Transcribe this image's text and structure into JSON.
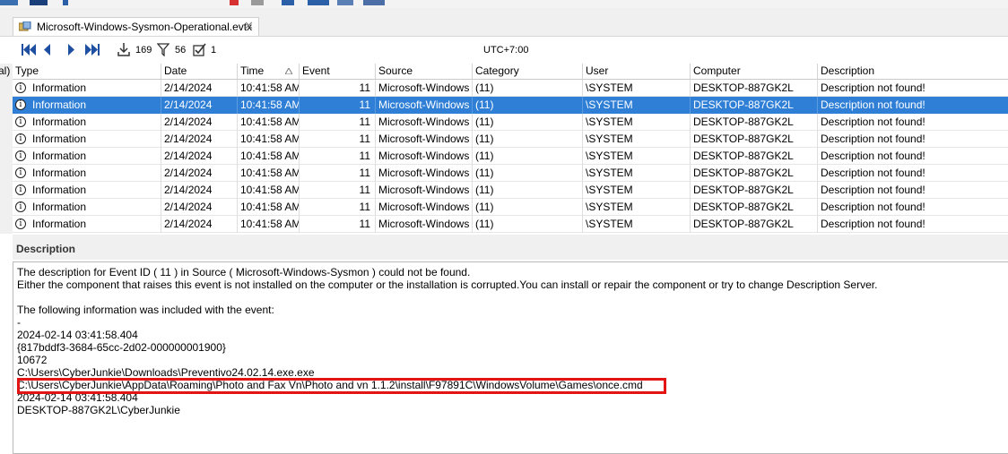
{
  "tab": {
    "title": "Microsoft-Windows-Sysmon-Operational.evtx"
  },
  "nav": {
    "count_total": "169",
    "count_filtered": "56",
    "count_checked": "1",
    "timezone": "UTC+7:00"
  },
  "grid": {
    "left_tick": "al)",
    "columns": [
      "Type",
      "Date",
      "Time",
      "Event",
      "Source",
      "Category",
      "User",
      "Computer",
      "Description"
    ],
    "rows": [
      [
        "Information",
        "2/14/2024",
        "10:41:58 AM",
        "11",
        "Microsoft-Windows",
        "(11)",
        "\\SYSTEM",
        "DESKTOP-887GK2L",
        "Description not found!"
      ],
      [
        "Information",
        "2/14/2024",
        "10:41:58 AM",
        "11",
        "Microsoft-Windows",
        "(11)",
        "\\SYSTEM",
        "DESKTOP-887GK2L",
        "Description not found!"
      ],
      [
        "Information",
        "2/14/2024",
        "10:41:58 AM",
        "11",
        "Microsoft-Windows",
        "(11)",
        "\\SYSTEM",
        "DESKTOP-887GK2L",
        "Description not found!"
      ],
      [
        "Information",
        "2/14/2024",
        "10:41:58 AM",
        "11",
        "Microsoft-Windows",
        "(11)",
        "\\SYSTEM",
        "DESKTOP-887GK2L",
        "Description not found!"
      ],
      [
        "Information",
        "2/14/2024",
        "10:41:58 AM",
        "11",
        "Microsoft-Windows",
        "(11)",
        "\\SYSTEM",
        "DESKTOP-887GK2L",
        "Description not found!"
      ],
      [
        "Information",
        "2/14/2024",
        "10:41:58 AM",
        "11",
        "Microsoft-Windows",
        "(11)",
        "\\SYSTEM",
        "DESKTOP-887GK2L",
        "Description not found!"
      ],
      [
        "Information",
        "2/14/2024",
        "10:41:58 AM",
        "11",
        "Microsoft-Windows",
        "(11)",
        "\\SYSTEM",
        "DESKTOP-887GK2L",
        "Description not found!"
      ],
      [
        "Information",
        "2/14/2024",
        "10:41:58 AM",
        "11",
        "Microsoft-Windows",
        "(11)",
        "\\SYSTEM",
        "DESKTOP-887GK2L",
        "Description not found!"
      ],
      [
        "Information",
        "2/14/2024",
        "10:41:58 AM",
        "11",
        "Microsoft-Windows",
        "(11)",
        "\\SYSTEM",
        "DESKTOP-887GK2L",
        "Description not found!"
      ]
    ],
    "selected_index": 1,
    "info_glyph": "i"
  },
  "description": {
    "header": "Description",
    "lines": [
      "The description for Event ID ( 11 ) in Source ( Microsoft-Windows-Sysmon ) could not be found.",
      "Either the component that raises this event is not installed on the computer or the installation is corrupted.You can install or repair the component or try to change Description Server.",
      "",
      "The following information was included with the event:",
      "-",
      "2024-02-14 03:41:58.404",
      "{817bddf3-3684-65cc-2d02-000000001900}",
      "10672",
      "C:\\Users\\CyberJunkie\\Downloads\\Preventivo24.02.14.exe.exe",
      "C:\\Users\\CyberJunkie\\AppData\\Roaming\\Photo and Fax Vn\\Photo and vn 1.1.2\\install\\F97891C\\WindowsVolume\\Games\\once.cmd",
      "2024-02-14 03:41:58.404",
      "DESKTOP-887GK2L\\CyberJunkie"
    ],
    "highlighted_line_index": 9
  },
  "colors": {
    "selection": "#2f7fd6",
    "highlight_border": "#e21414"
  }
}
